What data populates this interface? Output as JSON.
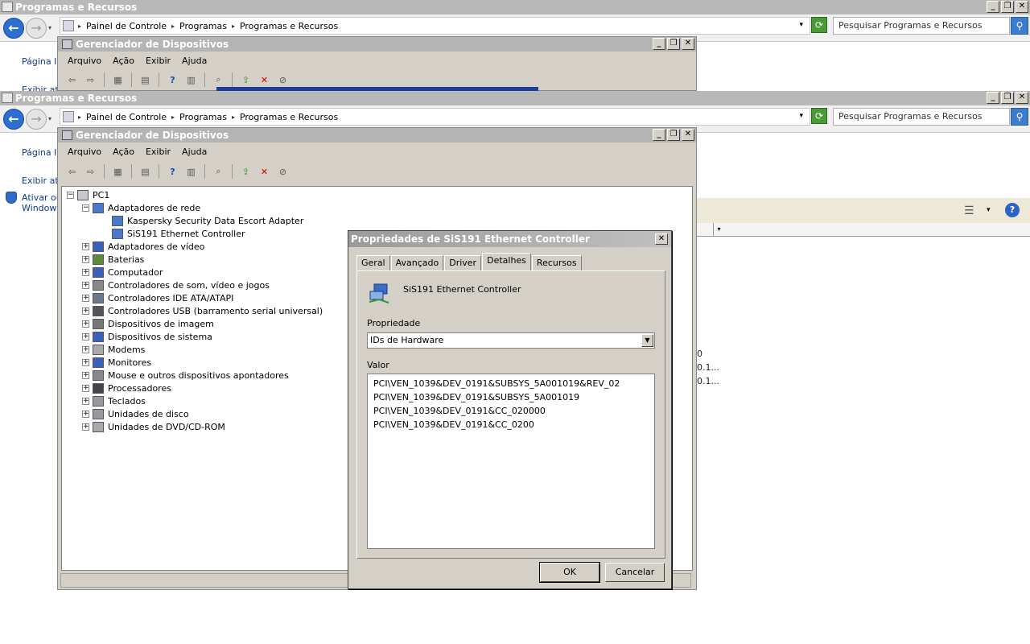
{
  "window": {
    "title": "Programas e Recursos",
    "minimize": "_",
    "restore": "❐",
    "close": "✕"
  },
  "nav": {
    "back_icon": "←",
    "forward_icon": "→",
    "breadcrumb": [
      "Painel de Controle",
      "Programas",
      "Programas e Recursos"
    ],
    "breadcrumb_arrow": "▸",
    "dropdown_arrow": "▾",
    "search_placeholder": "Pesquisar Programas e Recursos",
    "search_icon": "⚲"
  },
  "left_links": {
    "home": "Página In",
    "view": "Exibir atu",
    "activate": "Ativar ou",
    "windows": "Windows",
    "view_top": "Exibir atu"
  },
  "devmgr": {
    "title": "Gerenciador de Dispositivos",
    "menu": [
      "Arquivo",
      "Ação",
      "Exibir",
      "Ajuda"
    ],
    "tree_root": "PC1",
    "tree_expanded": "Adaptadores de rede",
    "tree_children": [
      "Kaspersky Security Data Escort Adapter",
      "SiS191 Ethernet Controller"
    ],
    "tree_categories": [
      "Adaptadores de vídeo",
      "Baterias",
      "Computador",
      "Controladores de som, vídeo e jogos",
      "Controladores IDE ATA/ATAPI",
      "Controladores USB (barramento serial universal)",
      "Dispositivos de imagem",
      "Dispositivos de sistema",
      "Modems",
      "Monitores",
      "Mouse e outros dispositivos apontadores",
      "Processadores",
      "Teclados",
      "Unidades de disco",
      "Unidades de DVD/CD-ROM"
    ]
  },
  "dialog": {
    "title": "Propriedades de SiS191 Ethernet Controller",
    "close": "✕",
    "tabs": [
      "Geral",
      "Avançado",
      "Driver",
      "Detalhes",
      "Recursos"
    ],
    "active_tab": "Detalhes",
    "device_name": "SiS191 Ethernet Controller",
    "property_label": "Propriedade",
    "property_value": "IDs de Hardware",
    "value_label": "Valor",
    "values": [
      "PCI\\VEN_1039&DEV_0191&SUBSYS_5A001019&REV_02",
      "PCI\\VEN_1039&DEV_0191&SUBSYS_5A001019",
      "PCI\\VEN_1039&DEV_0191&CC_020000",
      "PCI\\VEN_1039&DEV_0191&CC_0200"
    ],
    "ok": "OK",
    "cancel": "Cancelar"
  },
  "background_fragments": {
    "frag1": "0",
    "frag2": "0.1...",
    "frag3": "0.1..."
  },
  "colors": {
    "titlebar": "#b8b8b8",
    "dialog_face": "#d4d0c8",
    "link": "#0b3a8a"
  }
}
